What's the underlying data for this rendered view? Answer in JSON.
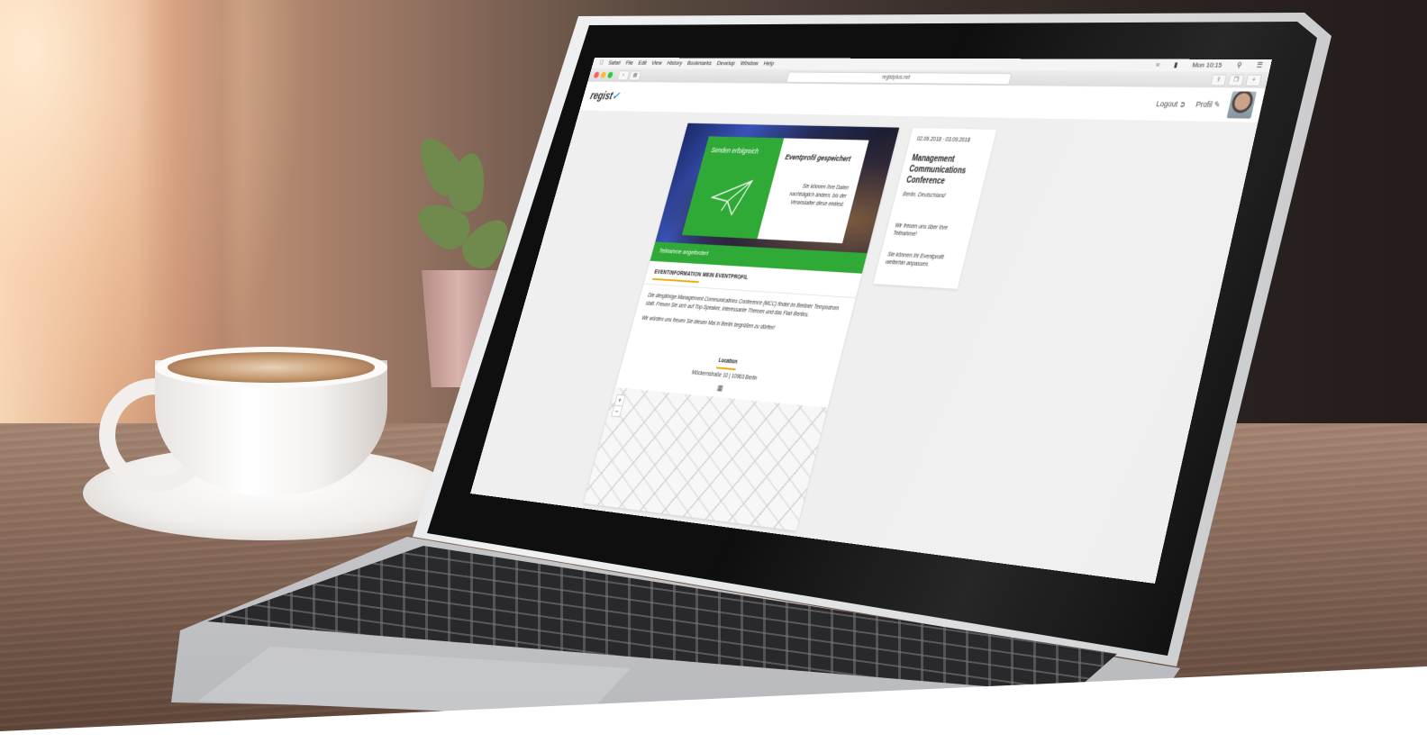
{
  "browser": {
    "menu": [
      "Safari",
      "File",
      "Edit",
      "View",
      "History",
      "Bookmarks",
      "Develop",
      "Window",
      "Help"
    ],
    "status": "Mon 10:15",
    "url": "registplus.net"
  },
  "app": {
    "logo": "regist",
    "logout": "Logout",
    "profile": "Profil"
  },
  "hero": {
    "success_title": "Senden erfolgreich",
    "info_title": "Eventprofil gespeichert",
    "info_text": "Sie können Ihre Daten nachträglich ändern, bis der Veranstalter diese einliest."
  },
  "banner": "Teilnahme angefordert",
  "tabs": [
    "EVENTINFORMATION",
    "MEIN EVENTPROFIL"
  ],
  "description": [
    "Die diesjährige Management Communications Conference (MCC) findet im Berliner Tempodrom statt. Freuen Sie sich auf Top-Speaker, interessante Themen und das Flair Berlins.",
    "Wir würden uns freuen Sie diesen Mai in Berlin begrüßen zu dürfen!"
  ],
  "location": {
    "title": "Location",
    "address": "Möckernstraße 10 | 10963 Berlin"
  },
  "map": {
    "zoom_in": "+",
    "zoom_out": "−"
  },
  "event": {
    "dates": "02.09.2018 · 03.09.2018",
    "title": "Management Communications Conference",
    "city": "Berlin, Deutschland",
    "message1": "Wir freuen uns über Ihre Teilnahme!",
    "message2": "Sie können Ihr Eventprofil weiterhin anpassen."
  },
  "colors": {
    "accent_green": "#2faa36",
    "accent_orange": "#f0a500",
    "link_blue": "#1e88e5"
  }
}
